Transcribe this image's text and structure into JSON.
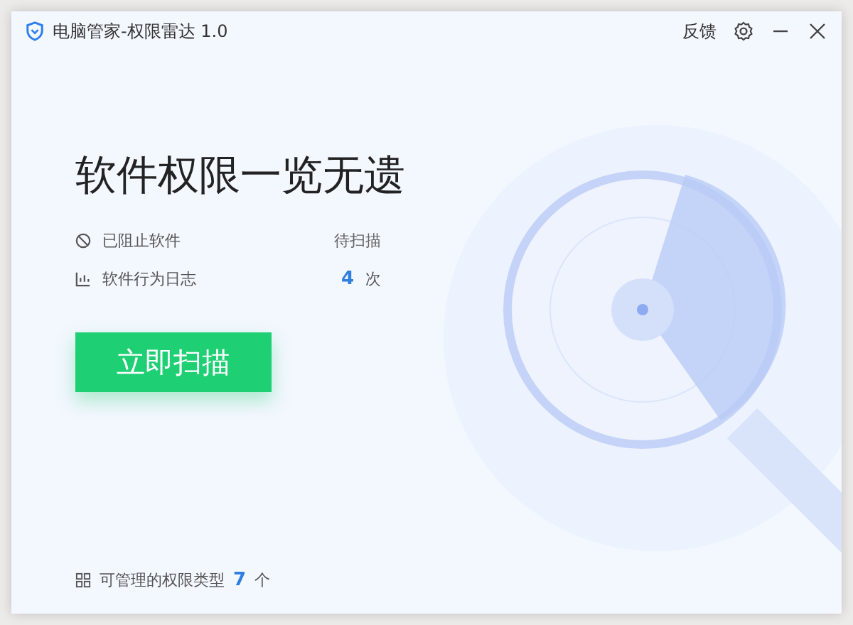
{
  "window": {
    "title": "电脑管家-权限雷达 1.0",
    "feedback": "反馈"
  },
  "headline": "软件权限一览无遗",
  "stats": [
    {
      "kind": "blocked",
      "label": "已阻止软件",
      "value": "待扫描"
    },
    {
      "kind": "log",
      "label": "软件行为日志",
      "value": "4",
      "unit": "次"
    }
  ],
  "scan_button": "立即扫描",
  "footer": {
    "label": "可管理的权限类型",
    "count": "7",
    "unit": "个"
  }
}
